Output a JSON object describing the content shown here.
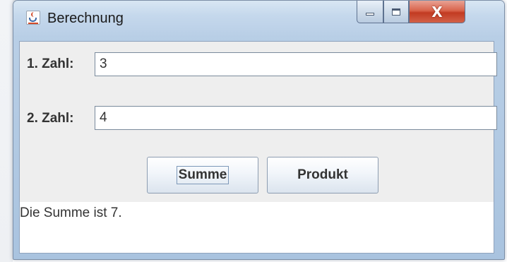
{
  "window": {
    "title": "Berechnung",
    "icon": "java-cup-icon",
    "controls": {
      "minimize": "minimize-icon",
      "maximize": "maximize-icon",
      "close_glyph": "X"
    }
  },
  "form": {
    "field1": {
      "label": "1. Zahl:",
      "value": "3"
    },
    "field2": {
      "label": "2. Zahl:",
      "value": "4"
    }
  },
  "buttons": {
    "summe": "Summe",
    "produkt": "Produkt"
  },
  "result": {
    "text": "Die Summe ist 7."
  },
  "colors": {
    "title_bar": "#c5d8ec",
    "close_button": "#c23b22",
    "panel": "#eeeeee",
    "text": "#333333"
  }
}
